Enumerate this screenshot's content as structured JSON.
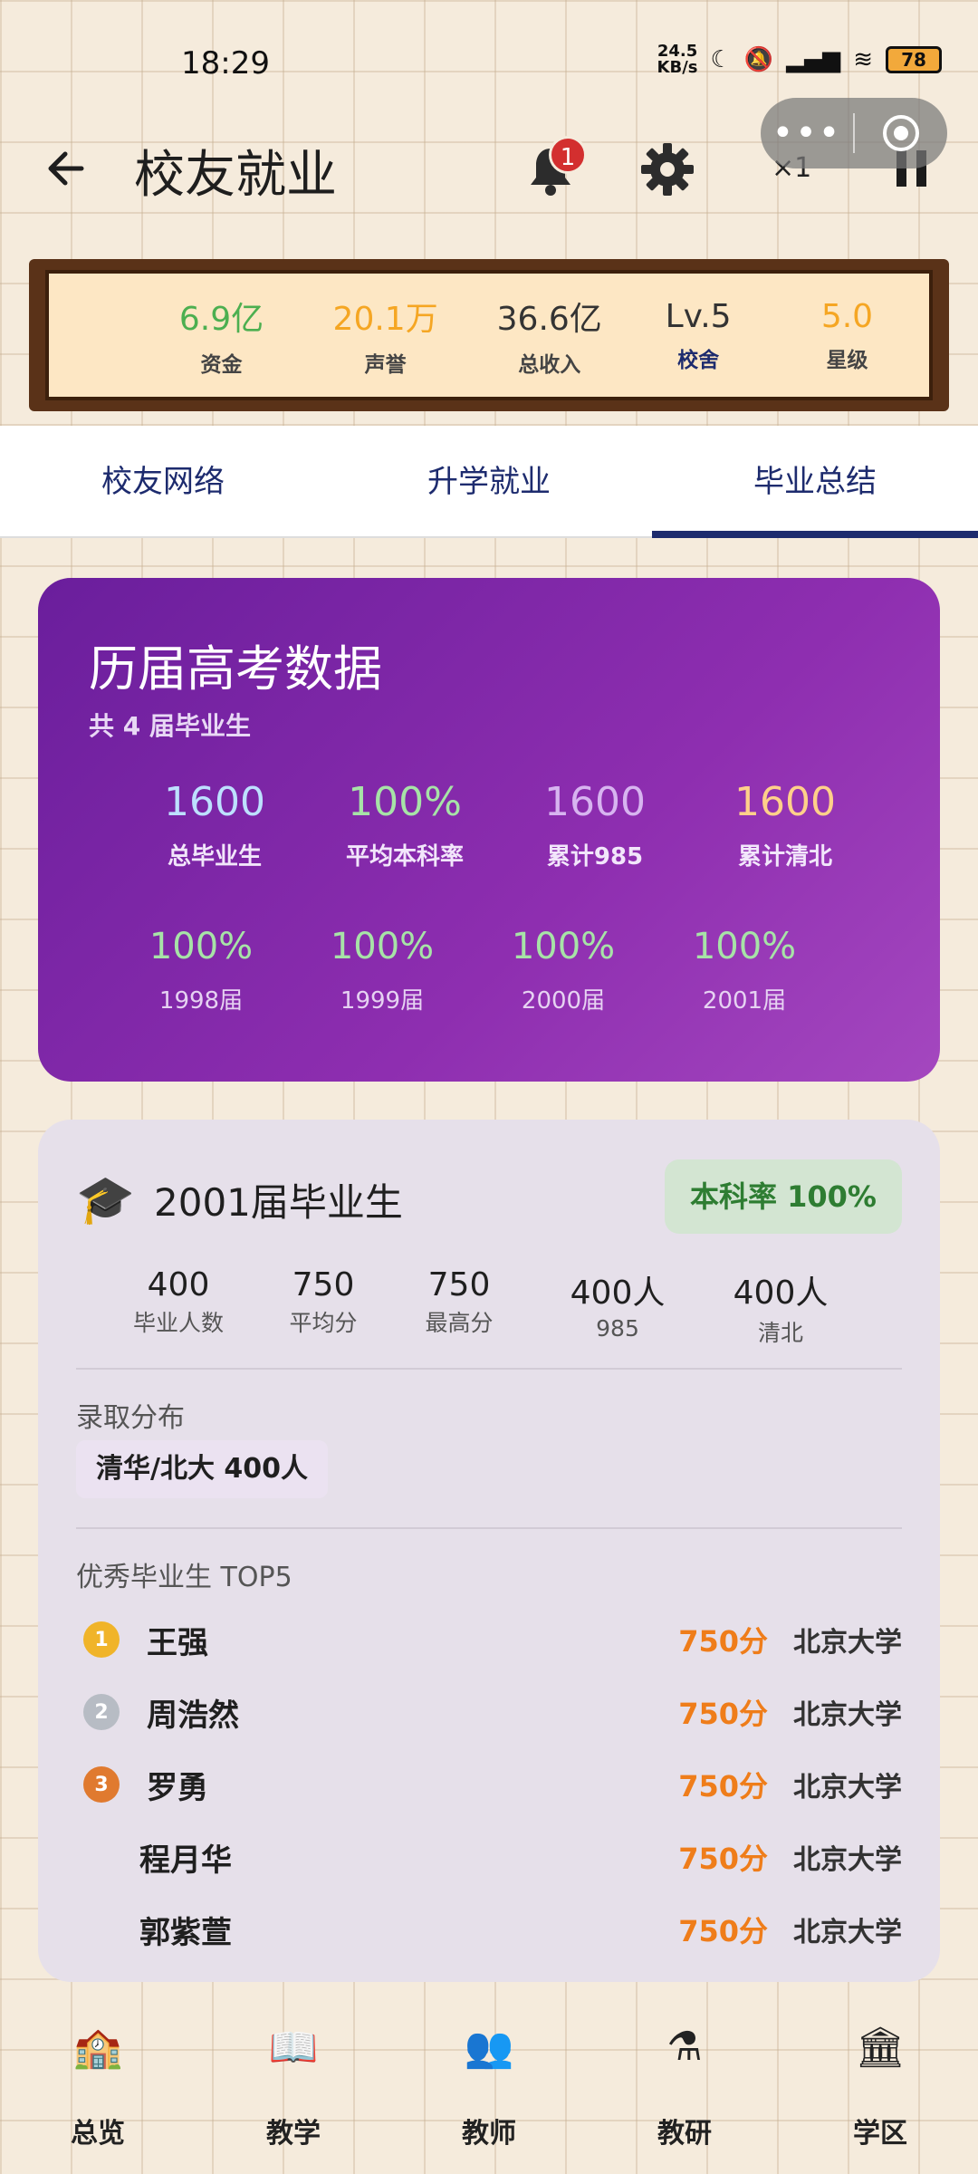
{
  "status": {
    "time": "18:29",
    "net_speed_top": "24.5",
    "net_speed_bottom": "KB/s",
    "battery": "78"
  },
  "header": {
    "title": "校友就业",
    "notification_count": "1",
    "speed": "×1"
  },
  "stats": [
    {
      "value": "6.9亿",
      "label": "资金",
      "color": "#4caf50"
    },
    {
      "value": "20.1万",
      "label": "声誉",
      "color": "#f5a623"
    },
    {
      "value": "36.6亿",
      "label": "总收入",
      "color": "#333333"
    },
    {
      "value": "Lv.5",
      "label": "校舍",
      "color": "#333333"
    },
    {
      "value": "5.0",
      "label": "星级",
      "color": "#f5a623"
    }
  ],
  "tabs": [
    {
      "label": "校友网络",
      "active": false
    },
    {
      "label": "升学就业",
      "active": false
    },
    {
      "label": "毕业总结",
      "active": true
    }
  ],
  "exam_card": {
    "title": "历届高考数据",
    "subtitle": "共 4 届毕业生",
    "summary": [
      {
        "value": "1600",
        "label": "总毕业生",
        "color": "#bde0ff"
      },
      {
        "value": "100%",
        "label": "平均本科率",
        "color": "#a7e3a7"
      },
      {
        "value": "1600",
        "label": "累计985",
        "color": "#d7b4f0"
      },
      {
        "value": "1600",
        "label": "累计清北",
        "color": "#ffd08a"
      }
    ],
    "years": [
      {
        "value": "100%",
        "label": "1998届"
      },
      {
        "value": "100%",
        "label": "1999届"
      },
      {
        "value": "100%",
        "label": "2000届"
      },
      {
        "value": "100%",
        "label": "2001届"
      }
    ]
  },
  "class_card": {
    "title": "2001届毕业生",
    "rate_badge": "本科率 100%",
    "metrics": [
      {
        "value": "400",
        "label": "毕业人数"
      },
      {
        "value": "750",
        "label": "平均分"
      },
      {
        "value": "750",
        "label": "最高分"
      },
      {
        "value": "400人",
        "label": "985"
      },
      {
        "value": "400人",
        "label": "清北"
      }
    ],
    "admission_label": "录取分布",
    "admission_chip": "清华/北大 400人",
    "top_label": "优秀毕业生 TOP5",
    "top": [
      {
        "rank": "1",
        "name": "王强",
        "score": "750分",
        "school": "北京大学",
        "medal": "gold"
      },
      {
        "rank": "2",
        "name": "周浩然",
        "score": "750分",
        "school": "北京大学",
        "medal": "silver"
      },
      {
        "rank": "3",
        "name": "罗勇",
        "score": "750分",
        "school": "北京大学",
        "medal": "bronze"
      },
      {
        "rank": "",
        "name": "程月华",
        "score": "750分",
        "school": "北京大学",
        "medal": "blank"
      },
      {
        "rank": "",
        "name": "郭紫萱",
        "score": "750分",
        "school": "北京大学",
        "medal": "blank"
      }
    ]
  },
  "bottom_nav": [
    {
      "label": "总览",
      "icon": "school-building-icon"
    },
    {
      "label": "教学",
      "icon": "open-book-icon"
    },
    {
      "label": "教师",
      "icon": "teachers-icon"
    },
    {
      "label": "教研",
      "icon": "flask-icon"
    },
    {
      "label": "学区",
      "icon": "campus-icon"
    }
  ]
}
